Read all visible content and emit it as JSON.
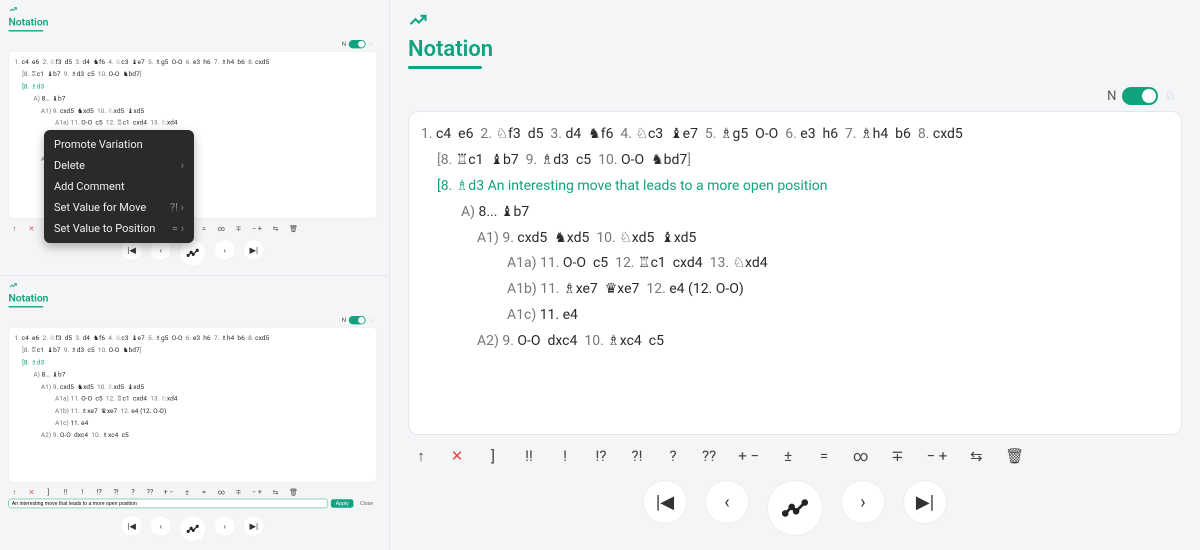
{
  "header": {
    "title": "Notation"
  },
  "toggle": {
    "label_left": "N",
    "knight_glyph": "♘"
  },
  "mainline": [
    {
      "n": "1.",
      "w": "c4",
      "b": "e6"
    },
    {
      "n": "2.",
      "w": "♘f3",
      "b": "d5"
    },
    {
      "n": "3.",
      "w": "d4",
      "b": "♞f6"
    },
    {
      "n": "4.",
      "w": "♘c3",
      "b": "♝e7"
    },
    {
      "n": "5.",
      "w": "♗g5",
      "b": "O-O"
    },
    {
      "n": "6.",
      "w": "e3",
      "b": "h6"
    },
    {
      "n": "7.",
      "w": "♗h4",
      "b": "b6"
    },
    {
      "n": "8.",
      "w": "cxd5",
      "b": ""
    }
  ],
  "var1": [
    {
      "n": "8.",
      "w": "♖c1",
      "b": "♝b7"
    },
    {
      "n": "9.",
      "w": "♗d3",
      "b": "c5"
    },
    {
      "n": "10.",
      "w": "O-O",
      "b": "♞bd7"
    }
  ],
  "var2": {
    "opener": "8. ♗d3",
    "comment": "An interesting move that leads to a more open position"
  },
  "A": {
    "label": "A)",
    "line": "8... ♝b7"
  },
  "A1": {
    "label": "A1)",
    "moves": [
      {
        "n": "9.",
        "w": "cxd5",
        "b": "♞xd5"
      },
      {
        "n": "10.",
        "w": "♘xd5",
        "b": "♝xd5"
      }
    ]
  },
  "A1a": {
    "label": "A1a)",
    "moves": [
      {
        "n": "11.",
        "w": "O-O",
        "b": "c5"
      },
      {
        "n": "12.",
        "w": "♖c1",
        "b": "cxd4"
      },
      {
        "n": "13.",
        "w": "♘xd4",
        "b": ""
      }
    ]
  },
  "A1b": {
    "label": "A1b)",
    "moves": [
      {
        "n": "11.",
        "w": "♗xe7",
        "b": "♛xe7"
      },
      {
        "n": "12.",
        "w": "e4",
        "b": ""
      }
    ],
    "tail": "(12. O-O)"
  },
  "A1c": {
    "label": "A1c)",
    "text": "11. e4"
  },
  "A2": {
    "label": "A2)",
    "moves": [
      {
        "n": "9.",
        "w": "O-O",
        "b": "dxc4"
      },
      {
        "n": "10.",
        "w": "♗xc4",
        "b": "c5"
      }
    ]
  },
  "toolbar": {
    "up": "↑",
    "del": "✕",
    "brk": "]",
    "dbang": "!!",
    "bang": "!",
    "intbang": "!?",
    "bangint": "?!",
    "q": "?",
    "qq": "??",
    "plusminus": "+ −",
    "pmbig": "±",
    "eq": "=",
    "inf": "∞",
    "eqplus": "∓",
    "minusplus": "− +",
    "swap": "⇆",
    "trash": "🗑"
  },
  "controls": {
    "first": "⏮",
    "prev": "‹",
    "graph": "chart",
    "next": "›",
    "last": "⏭"
  },
  "ctx_menu": {
    "items": [
      {
        "label": "Promote Variation",
        "sub": false
      },
      {
        "label": "Delete",
        "sub": true
      },
      {
        "label": "Add Comment",
        "sub": false
      },
      {
        "label": "Set Value for Move",
        "sub": true,
        "hint": "?!"
      },
      {
        "label": "Set Value to Position",
        "sub": true,
        "hint": "="
      }
    ]
  },
  "comment_input": {
    "value": "An interesting move that leads to a more open position",
    "apply": "Apply",
    "close": "Close"
  }
}
